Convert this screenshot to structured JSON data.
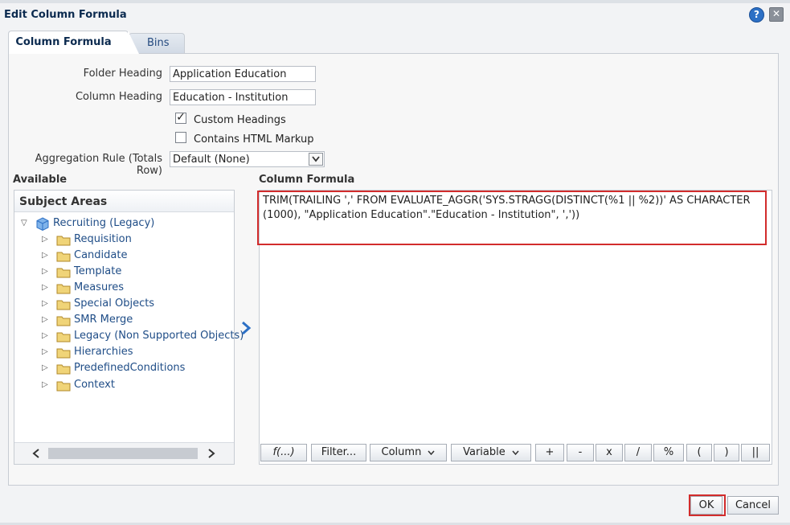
{
  "dialog": {
    "title": "Edit Column Formula"
  },
  "tabs": [
    {
      "label": "Column Formula",
      "active": true
    },
    {
      "label": "Bins",
      "active": false
    }
  ],
  "form": {
    "folder_heading_label": "Folder Heading",
    "folder_heading_value": "Application Education",
    "column_heading_label": "Column Heading",
    "column_heading_value": "Education - Institution",
    "custom_headings_label": "Custom Headings",
    "custom_headings_checked": true,
    "html_markup_label": "Contains HTML Markup",
    "html_markup_checked": false,
    "aggregation_label": "Aggregation Rule (Totals Row)",
    "aggregation_value": "Default (None)"
  },
  "available": {
    "heading": "Available",
    "panel_title": "Subject Areas",
    "root": "Recruiting (Legacy)",
    "folders": [
      "Requisition",
      "Candidate",
      "Template",
      "Measures",
      "Special Objects",
      "SMR Merge",
      "Legacy (Non Supported Objects)",
      "Hierarchies",
      "PredefinedConditions",
      "Context"
    ]
  },
  "formula": {
    "heading": "Column Formula",
    "text": "TRIM(TRAILING ',' FROM EVALUATE_AGGR('SYS.STRAGG(DISTINCT(%1 || %2))' AS CHARACTER (1000), \"Application Education\".\"Education - Institution\", ','))",
    "buttons": [
      "f(...)",
      "Filter...",
      "Column",
      "Variable",
      "+",
      "-",
      "x",
      "/",
      "%",
      "(",
      ")",
      "||"
    ]
  },
  "footer": {
    "ok_label": "OK",
    "cancel_label": "Cancel"
  },
  "colors": {
    "highlight": "#d22c2c",
    "link": "#1f4d87",
    "accent": "#2d70c5"
  }
}
